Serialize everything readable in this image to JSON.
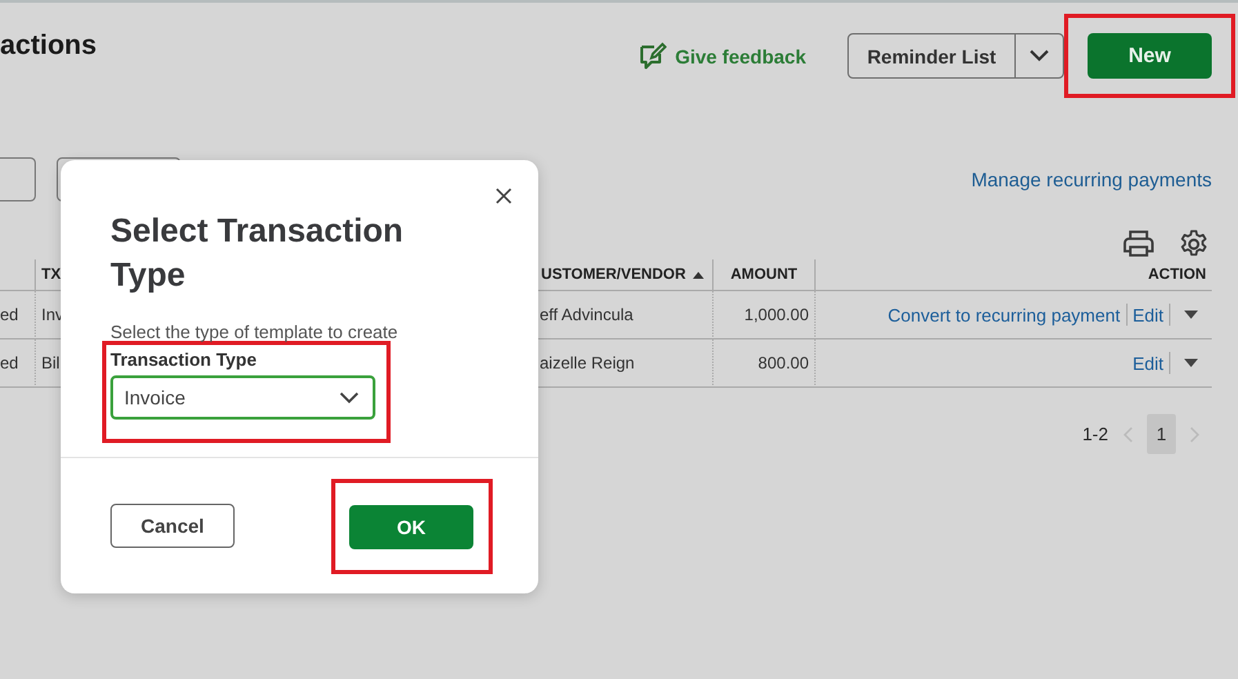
{
  "page": {
    "title": "actions",
    "feedback_link": "Give feedback",
    "reminder_button": "Reminder List",
    "new_button": {
      "label": "New",
      "highlighted": true
    },
    "manage_link": "Manage recurring payments"
  },
  "table": {
    "columns": [
      {},
      {
        "label": "TX"
      },
      {
        "label": "USTOMER/VENDOR",
        "sorted": true
      },
      {
        "label": "AMOUNT"
      },
      {
        "label": "ACTION"
      }
    ],
    "rows": [
      {
        "cells": [
          "ed",
          "Inv",
          "eff Advincula",
          "1,000.00"
        ],
        "actions": [
          "Convert to recurring payment",
          "Edit"
        ]
      },
      {
        "cells": [
          "ed",
          "Bil",
          "aizelle Reign",
          "800.00"
        ],
        "actions": [
          "Edit"
        ]
      }
    ]
  },
  "pagination": {
    "range": "1-2",
    "pages": [
      {
        "label": "1",
        "selected": true
      }
    ]
  },
  "dialog": {
    "title": "Select Transaction Type",
    "subtitle": "Select the type of template to create",
    "field": {
      "label": "Transaction Type",
      "value": "Invoice",
      "highlighted": true
    },
    "buttons": [
      {
        "label": "Cancel",
        "kind": "secondary",
        "highlighted": false
      },
      {
        "label": "OK",
        "kind": "primary",
        "highlighted": true
      }
    ]
  }
}
